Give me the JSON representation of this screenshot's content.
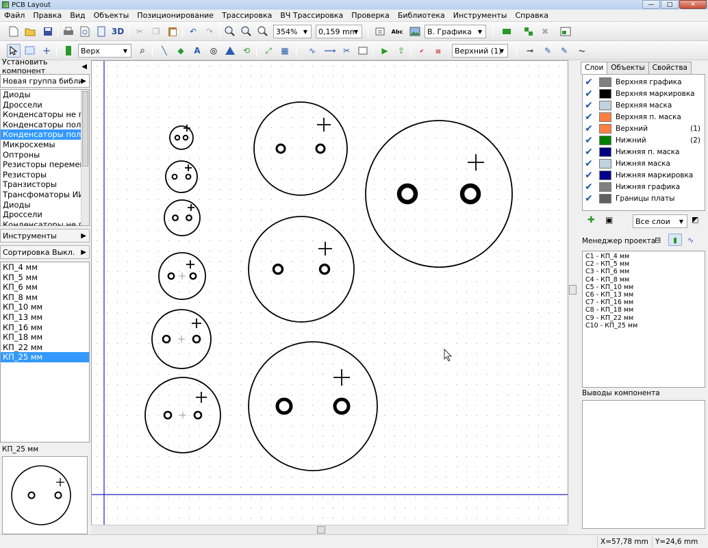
{
  "window": {
    "title": "PCB Layout"
  },
  "menu": [
    "Файл",
    "Правка",
    "Вид",
    "Объекты",
    "Позиционирование",
    "Трассировка",
    "ВЧ Трассировка",
    "Проверка",
    "Библиотека",
    "Инструменты",
    "Справка"
  ],
  "toolbar1": {
    "view3d_label": "3D",
    "zoom_value": "354%",
    "grid_value": "0,159 mm",
    "layer_view_value": "В. Графика"
  },
  "toolbar2": {
    "side_value": "Верх",
    "layer_value": "Верхний (1)"
  },
  "left": {
    "install_component_label": "Установить компонент",
    "new_group_label": "Новая группа библиотек",
    "groups": [
      "Диоды",
      "Дроссели",
      "Конденсаторы не поляр.",
      "Конденсаторы поляр.",
      "Конденсаторы поляр.",
      "Микросхемы",
      "Оптроны",
      "Резисторы переменные",
      "Резисторы",
      "Транзисторы",
      "Трансфоматоры ИИП",
      "Диоды",
      "Дроссели",
      "Конденсаторы не поляр."
    ],
    "groups_selected_index": 4,
    "tools_label": "Инструменты",
    "sort_label": "Сортировка Выкл.",
    "components": [
      "КП_4 мм",
      "КП_5 мм",
      "КП_6 мм",
      "КП_8 мм",
      "КП_10 мм",
      "КП_13 мм",
      "КП_16 мм",
      "КП_18 мм",
      "КП_22 мм",
      "КП_25 мм"
    ],
    "components_selected_index": 9,
    "preview_label": "КП_25 мм"
  },
  "right": {
    "tabs": [
      "Слои",
      "Объекты",
      "Свойства"
    ],
    "active_tab_index": 0,
    "layers": [
      {
        "name": "Верхняя графика",
        "color": "#808080",
        "num": ""
      },
      {
        "name": "Верхняя маркировка",
        "color": "#000000",
        "num": ""
      },
      {
        "name": "Верхняя маска",
        "color": "#bfd3de",
        "num": ""
      },
      {
        "name": "Верхняя п. маска",
        "color": "#ff8040",
        "num": ""
      },
      {
        "name": "Верхний",
        "color": "#ff8040",
        "num": "(1)"
      },
      {
        "name": "Нижний",
        "color": "#008000",
        "num": "(2)"
      },
      {
        "name": "Нижняя п. маска",
        "color": "#000080",
        "num": ""
      },
      {
        "name": "Нижняя маска",
        "color": "#bfd3de",
        "num": ""
      },
      {
        "name": "Нижняя маркировка",
        "color": "#00008b",
        "num": ""
      },
      {
        "name": "Нижняя графика",
        "color": "#808080",
        "num": ""
      },
      {
        "name": "Границы платы",
        "color": "#606060",
        "num": ""
      }
    ],
    "all_layers_value": "Все слои",
    "project_manager_label": "Менеджер проекта",
    "project_items": [
      "C1 - КП_4 мм",
      "C2 - КП_5 мм",
      "C3 - КП_6 мм",
      "C4 - КП_8 мм",
      "C5 - КП_10 мм",
      "C6 - КП_13 мм",
      "C7 - КП_16 мм",
      "C8 - КП_18 мм",
      "C9 - КП_22 мм",
      "C10 - КП_25 мм"
    ],
    "pins_label": "Выводы компонента"
  },
  "status": {
    "x": "X=57,78 mm",
    "y": "Y=24,6 mm"
  },
  "colors": {
    "selection": "#3399ff",
    "grid_dot": "#9a9a9a",
    "board_line": "#2020c0",
    "accent_check": "#1e5aa8"
  }
}
